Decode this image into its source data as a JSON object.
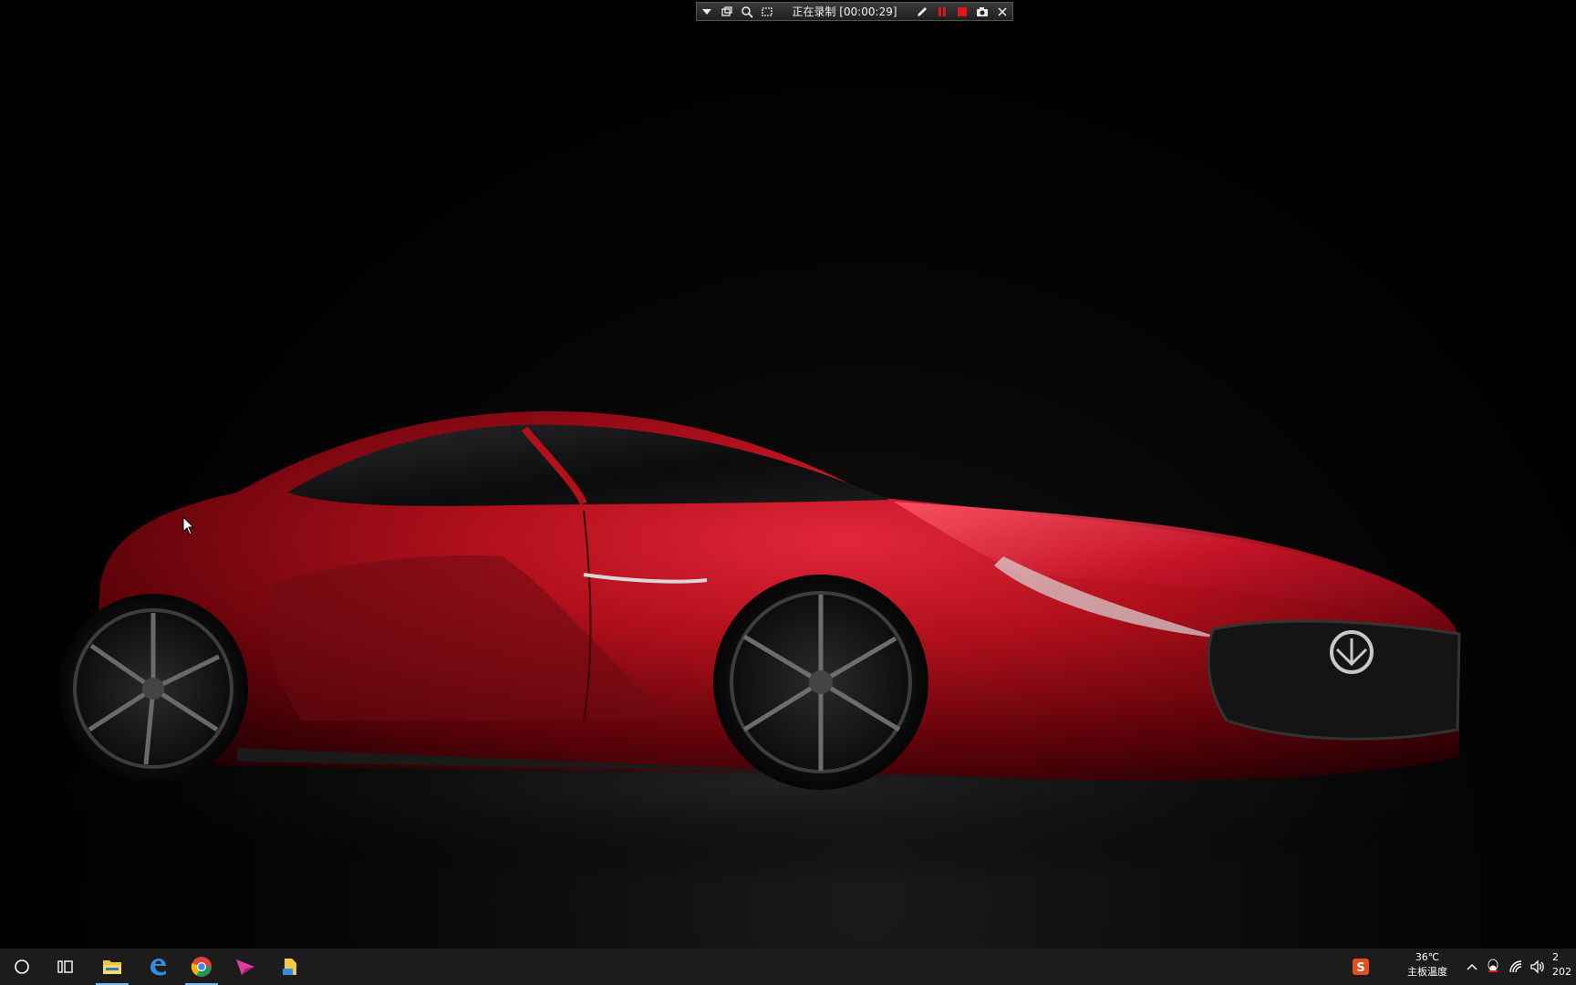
{
  "recording_toolbar": {
    "status": "正在录制 [00:00:29]",
    "icons": [
      "dropdown-arrow-icon",
      "window-icon",
      "zoom-icon",
      "region-select-icon",
      "pen-icon",
      "pause-icon",
      "stop-icon",
      "camera-icon",
      "close-icon"
    ],
    "accent_color": "#e0161b"
  },
  "wallpaper": {
    "subject": "red-sports-car",
    "body_color": "#b3101c"
  },
  "taskbar": {
    "pinned_apps": [
      "file-explorer",
      "edge",
      "chrome",
      "arrow-app",
      "file-manager-app"
    ],
    "tray": {
      "sogou_icon_label": "S",
      "temperature": "36℃",
      "temperature_label": "主板温度",
      "clock_time": "2",
      "clock_date": "202"
    }
  }
}
